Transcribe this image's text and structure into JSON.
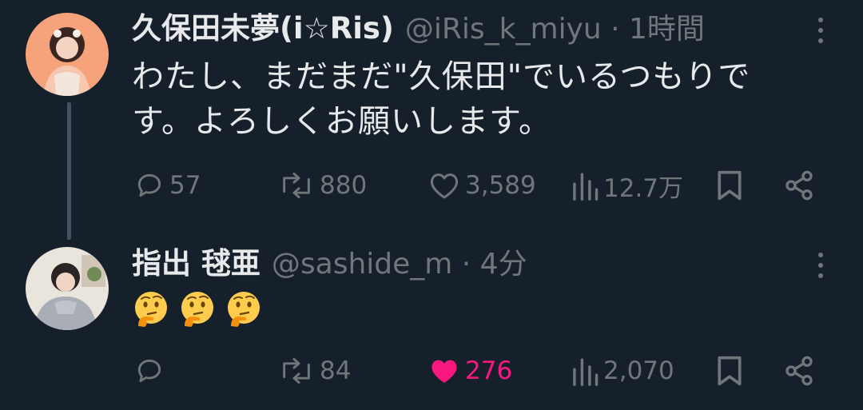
{
  "tweets": [
    {
      "display_name": "久保田未夢(i☆Ris)",
      "meta": "@iRis_k_miyu · 1時間",
      "text": "わたし、まだまだ\"久保田\"でいるつもりです。よろしくお願いします。",
      "replies": "57",
      "retweets": "880",
      "likes": "3,589",
      "views": "12.7万",
      "liked": false
    },
    {
      "display_name": "指出 毬亜",
      "meta": "@sashide_m · 4分",
      "replies": "",
      "retweets": "84",
      "likes": "276",
      "views": "2,070",
      "liked": true,
      "emojis": [
        "thinking-face",
        "thinking-face",
        "thinking-face"
      ]
    }
  ],
  "colors": {
    "background": "#15202b",
    "text": "#e7e9ea",
    "secondary": "#71767b",
    "like_active": "#f91880",
    "thread_line": "#425364"
  }
}
